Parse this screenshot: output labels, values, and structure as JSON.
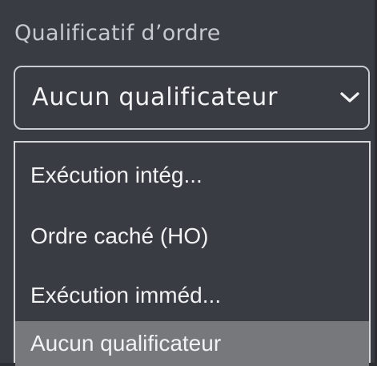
{
  "field": {
    "label": "Qualificatif d’ordre",
    "selected_value": "Aucun qualificateur",
    "chevron_icon": "chevron-down-icon"
  },
  "dropdown": {
    "options": [
      {
        "label": "Exécution intég..."
      },
      {
        "label": "Ordre caché (HO)"
      },
      {
        "label": "Exécution imméd..."
      },
      {
        "label": "Aucun qualificateur",
        "selected": true
      }
    ]
  },
  "colors": {
    "panel_bg": "#393c42",
    "border": "#c9ccd0",
    "text": "#f1f2f4",
    "label_text": "#c6c9cd",
    "selected_bg": "#77787b"
  }
}
